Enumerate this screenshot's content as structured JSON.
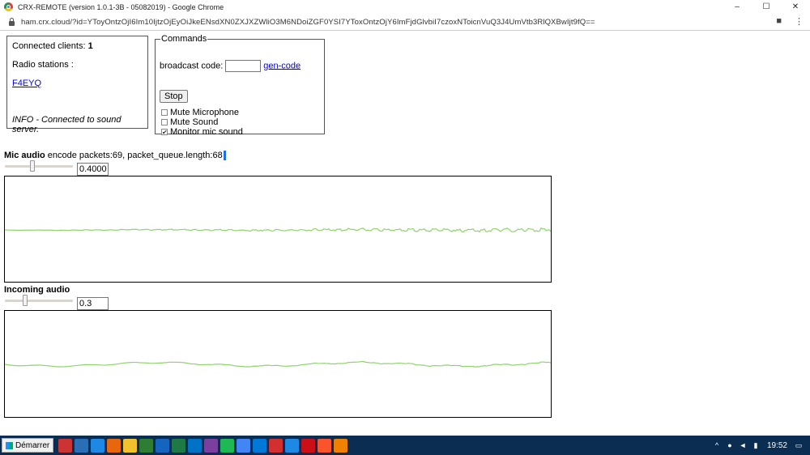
{
  "window": {
    "title": "CRX-REMOTE (version 1.0.1-3B - 05082019) - Google Chrome",
    "controls": [
      "–",
      "☐",
      "✕"
    ]
  },
  "address": {
    "url": "ham.crx.cloud/?id=YToyOntzOjI6Im10IjtzOjEyOiJkeENsdXN0ZXJXZWliO3M6NDoiZGF0YSI7YToxOntzOjY6ImFjdGlvbiI7czoxNToicnVuQ3J4UmVtb3RlQXBwIjt9fQ=="
  },
  "status_panel": {
    "connected_label": "Connected clients: ",
    "connected_count": "1",
    "radio_label": "Radio stations :",
    "station": "F4EYQ",
    "info": "INFO - Connected to sound server."
  },
  "commands": {
    "legend": "Commands",
    "broadcast_label": "broadcast code:",
    "broadcast_value": "",
    "gen_code": "gen-code",
    "stop": "Stop",
    "checkboxes": [
      {
        "label": "Mute Microphone",
        "checked": false
      },
      {
        "label": "Mute Sound",
        "checked": false
      },
      {
        "label": "Monitor mic sound",
        "checked": true
      }
    ]
  },
  "mic": {
    "label": "Mic audio",
    "status": " encode packets:69, packet_queue.length:68",
    "slider_fraction": 0.4,
    "value": "0.4000"
  },
  "incoming": {
    "label": "Incoming audio",
    "slider_fraction": 0.3,
    "value": "0.3"
  },
  "colors": {
    "waveform": "#8fd36c",
    "link": "#0000ee",
    "taskbar": "#0b2d52"
  },
  "taskbar": {
    "start": "Démarrer",
    "apps": [
      "clock-app-icon",
      "explorer-icon",
      "edge-icon",
      "firefox-icon",
      "folder-icon",
      "network-icon",
      "word-icon",
      "excel-icon",
      "outlook-icon",
      "onenote-icon",
      "spotify-icon",
      "chrome-icon",
      "vscode-icon",
      "acrobat-icon",
      "ie-icon",
      "opera-icon",
      "brave-icon",
      "vlc-icon"
    ],
    "tray_icons": [
      "chevron-up-icon",
      "microphone-icon",
      "volume-icon",
      "battery-icon",
      "notification-icon"
    ],
    "clock": "19:52"
  }
}
